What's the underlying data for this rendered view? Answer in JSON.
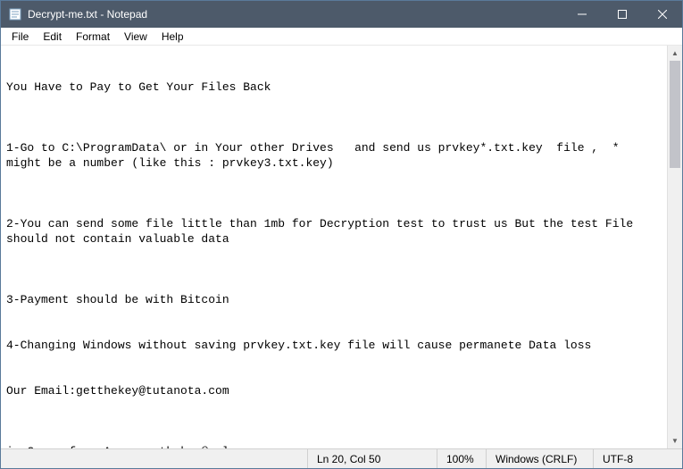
{
  "titlebar": {
    "title": "Decrypt-me.txt - Notepad"
  },
  "menubar": {
    "items": [
      "File",
      "Edit",
      "Format",
      "View",
      "Help"
    ]
  },
  "content": {
    "text": "\n\nYou Have to Pay to Get Your Files Back\n\n\n\n1-Go to C:\\ProgramData\\ or in Your other Drives   and send us prvkey*.txt.key  file ,  *  might be a number (like this : prvkey3.txt.key)\n\n\n\n2-You can send some file little than 1mb for Decryption test to trust us But the test File should not contain valuable data\n\n\n\n3-Payment should be with Bitcoin\n\n\n4-Changing Windows without saving prvkey.txt.key file will cause permanete Data loss\n\n\nOur Email:getthekey@tutanota.com\n\n\n\nin Case of no Answer:gthekey@aol.com"
  },
  "statusbar": {
    "position": "Ln 20, Col 50",
    "zoom": "100%",
    "eol": "Windows (CRLF)",
    "encoding": "UTF-8"
  }
}
